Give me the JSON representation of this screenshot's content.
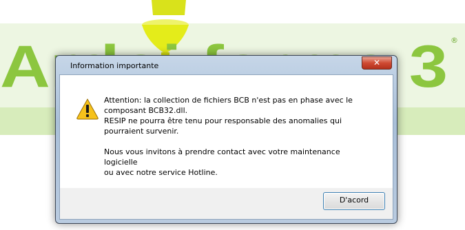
{
  "background": {
    "logo_text": "Ardoi farma 3",
    "logo_mark": "®"
  },
  "dialog": {
    "title": "Information importante",
    "close_label": "✕",
    "icon": "warning-icon",
    "message_lines": [
      "Attention: la collection de fichiers BCB n'est pas en phase avec le",
      "composant BCB32.dll.",
      "RESIP ne pourra être tenu pour responsable des anomalies qui",
      "pourraient survenir."
    ],
    "message_lines_2": [
      "Nous vous invitons à prendre contact avec votre maintenance logicielle",
      "ou avec notre service Hotline."
    ],
    "ok_label": "D'acord"
  },
  "colors": {
    "logo_green": "#8cc63f",
    "logo_yellow": "#e8ee18",
    "band_green": "#d6ecb9"
  }
}
